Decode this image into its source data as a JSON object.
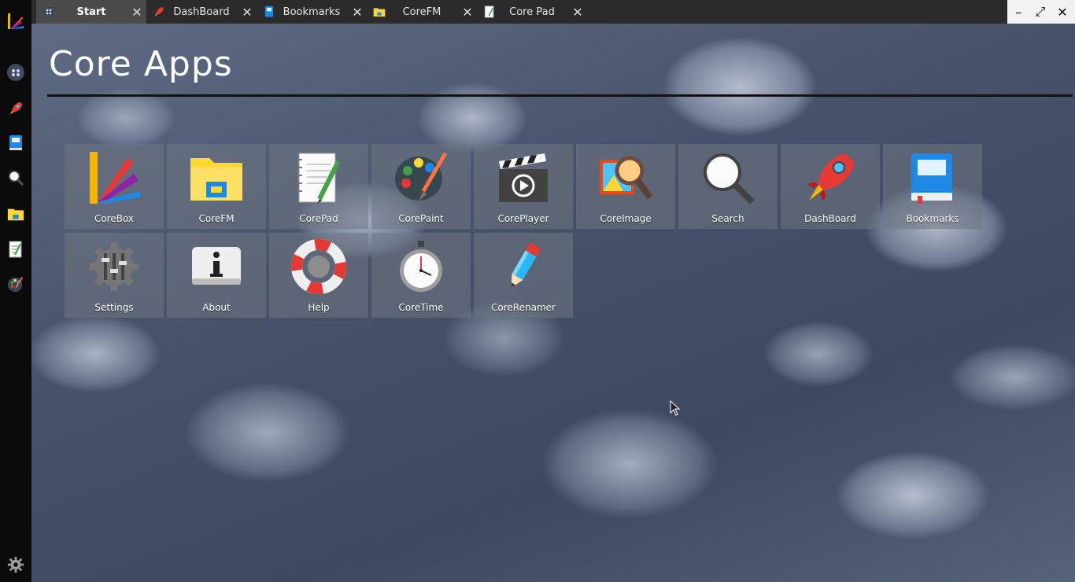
{
  "window": {
    "tabs": [
      {
        "label": "Start",
        "icon": "coreapps-icon",
        "active": true
      },
      {
        "label": "DashBoard",
        "icon": "rocket-icon",
        "active": false
      },
      {
        "label": "Bookmarks",
        "icon": "bookmark-book-icon",
        "active": false
      },
      {
        "label": "CoreFM",
        "icon": "folder-icon",
        "active": false
      },
      {
        "label": "Core Pad",
        "icon": "notepad-icon",
        "active": false
      }
    ],
    "close_glyph": "✕",
    "controls": {
      "minimize": "–",
      "maximize": "⤢",
      "close": "✕"
    }
  },
  "dock": {
    "items": [
      "coreapps-logo-icon",
      "start-icon",
      "rocket-icon",
      "bookmark-book-icon",
      "search-icon",
      "folder-icon",
      "notepad-icon",
      "paint-palette-icon"
    ],
    "bottom": "gear-icon"
  },
  "header": {
    "title": "Core Apps"
  },
  "apps": [
    {
      "label": "CoreBox",
      "icon": "corebox-icon"
    },
    {
      "label": "CoreFM",
      "icon": "folder-icon"
    },
    {
      "label": "CorePad",
      "icon": "notepad-icon"
    },
    {
      "label": "CorePaint",
      "icon": "paint-palette-icon"
    },
    {
      "label": "CorePlayer",
      "icon": "clapperboard-icon"
    },
    {
      "label": "CoreImage",
      "icon": "image-magnifier-icon"
    },
    {
      "label": "Search",
      "icon": "search-icon"
    },
    {
      "label": "DashBoard",
      "icon": "rocket-icon"
    },
    {
      "label": "Bookmarks",
      "icon": "bookmark-book-icon"
    },
    {
      "label": "Settings",
      "icon": "settings-sliders-icon"
    },
    {
      "label": "About",
      "icon": "info-icon"
    },
    {
      "label": "Help",
      "icon": "lifebuoy-icon"
    },
    {
      "label": "CoreTime",
      "icon": "stopwatch-icon"
    },
    {
      "label": "CoreRenamer",
      "icon": "pencil-icon"
    }
  ],
  "colors": {
    "tabbar": "#2b2b2b",
    "active_tab": "#4a4a4a",
    "dock": "#0b0b0b",
    "tile": "#6e7682"
  }
}
